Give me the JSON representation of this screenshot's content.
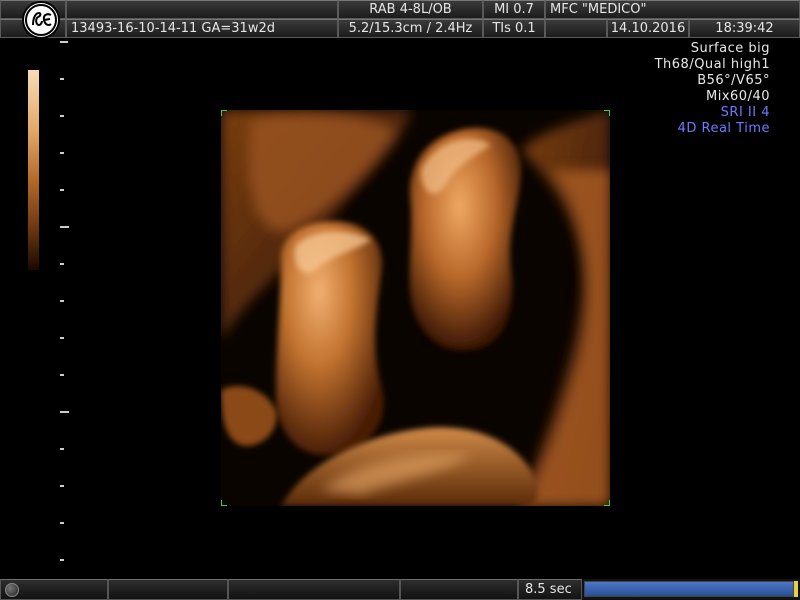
{
  "header": {
    "probe": "RAB 4-8L/OB",
    "mi": "MI  0.7",
    "institution": "MFC \"MEDICO\"",
    "patient_id": "13493-16-10-14-11  GA=31w2d",
    "depth_freq": "5.2/15.3cm / 2.4Hz",
    "tis": "TIs  0.1",
    "date": "14.10.2016",
    "time": "18:39:42"
  },
  "render_info": [
    {
      "text": "Surface big",
      "highlight": false
    },
    {
      "text": "Th68/Qual high1",
      "highlight": false
    },
    {
      "text": "B56°/V65°",
      "highlight": false
    },
    {
      "text": "Mix60/40",
      "highlight": false
    },
    {
      "text": "SRI II 4",
      "highlight": true
    },
    {
      "text": "4D Real Time",
      "highlight": true
    }
  ],
  "footer": {
    "cine_time": "8.5 sec",
    "cine_progress": 1.0
  },
  "colors": {
    "accent_blue": "#6b7bff",
    "roi_corner": "#3fd03f",
    "progress": "#3a64b0"
  },
  "icons": {
    "logo": "ge-logo-icon",
    "trackball": "trackball-icon"
  }
}
